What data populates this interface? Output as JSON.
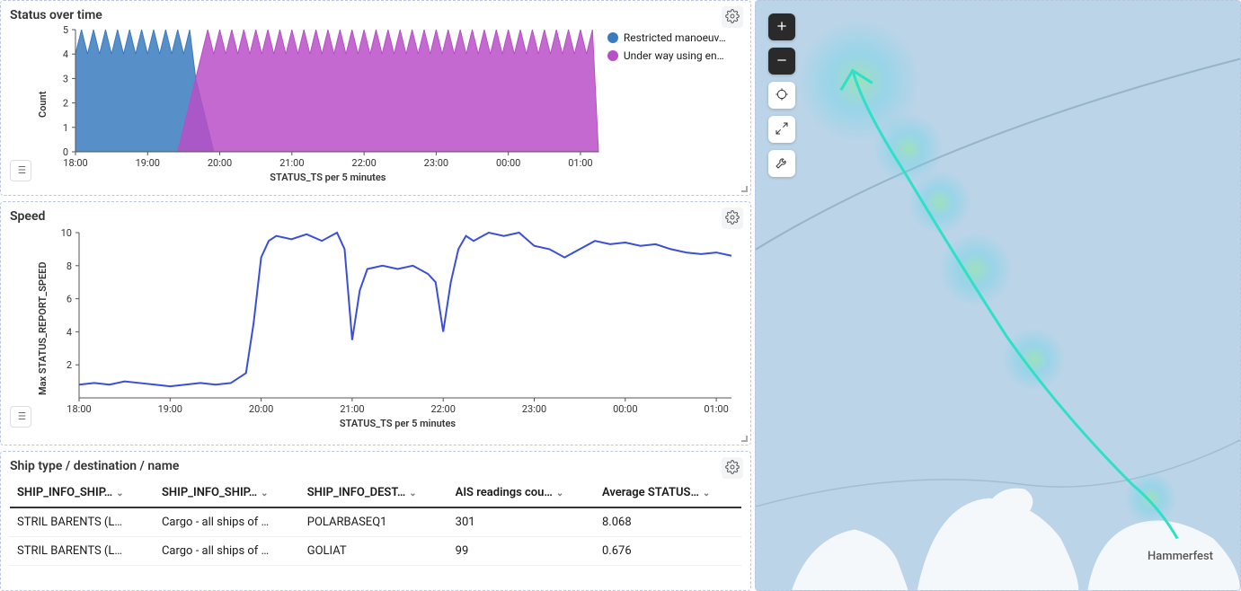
{
  "panels": {
    "status": {
      "title": "Status over time",
      "ylabel": "Count",
      "xlabel": "STATUS_TS per 5 minutes",
      "legend": [
        {
          "label": "Restricted manoeuv…",
          "color": "#3a7bbf"
        },
        {
          "label": "Under way using en…",
          "color": "#b84fc7"
        }
      ]
    },
    "speed": {
      "title": "Speed",
      "ylabel": "Max STATUS_REPORT_SPEED",
      "xlabel": "STATUS_TS per 5 minutes"
    },
    "table": {
      "title": "Ship type / destination / name",
      "headers": [
        "SHIP_INFO_SHIP…",
        "SHIP_INFO_SHIP…",
        "SHIP_INFO_DEST…",
        "AIS readings cou…",
        "Average STATUS…"
      ],
      "rows": [
        {
          "c0": "STRIL BARENTS (L…",
          "c1": "Cargo - all ships of …",
          "c2": "POLARBASEQ1",
          "c3": "301",
          "c4": "8.068"
        },
        {
          "c0": "STRIL BARENTS (L…",
          "c1": "Cargo - all ships of …",
          "c2": "GOLIAT",
          "c3": "99",
          "c4": "0.676"
        }
      ]
    }
  },
  "map": {
    "place_label": "Hammerfest",
    "heat_color_inner": "#7cf08a",
    "heat_color_outer": "#64d4e8",
    "track_color": "#2fe0c9",
    "baseline_color": "#6f95aa"
  },
  "chart_data": [
    {
      "type": "area",
      "title": "Status over time",
      "xlabel": "STATUS_TS per 5 minutes",
      "ylabel": "Count",
      "ylim": [
        0,
        5
      ],
      "x_ticks": [
        "18:00",
        "19:00",
        "20:00",
        "21:00",
        "22:00",
        "23:00",
        "00:00",
        "01:00"
      ],
      "y_ticks": [
        0,
        1,
        2,
        3,
        4,
        5
      ],
      "categories_minutes": [
        0,
        5,
        10,
        15,
        20,
        25,
        30,
        35,
        40,
        45,
        50,
        55,
        60,
        65,
        70,
        75,
        80,
        85,
        90,
        95,
        100,
        105,
        110,
        115,
        120,
        125,
        130,
        135,
        140,
        145,
        150,
        155,
        160,
        165,
        170,
        175,
        180,
        185,
        190,
        195,
        200,
        205,
        210,
        215,
        220,
        225,
        230,
        235,
        240,
        245,
        250,
        255,
        260,
        265,
        270,
        275,
        280,
        285,
        290,
        295,
        300,
        305,
        310,
        315,
        320,
        325,
        330,
        335,
        340,
        345,
        350,
        355,
        360,
        365,
        370,
        375,
        380,
        385,
        390,
        395,
        400,
        405,
        410,
        415,
        420,
        425,
        430,
        435
      ],
      "series": [
        {
          "name": "Restricted manoeuvrability",
          "color": "#3a7bbf",
          "values": [
            4,
            5,
            4,
            5,
            4,
            5,
            4,
            5,
            4,
            5,
            4,
            5,
            4,
            5,
            4,
            5,
            4,
            5,
            4,
            5,
            3,
            2,
            1,
            0,
            0,
            0,
            0,
            0,
            0,
            0,
            0,
            0,
            0,
            0,
            0,
            0,
            0,
            0,
            0,
            0,
            0,
            0,
            0,
            0,
            0,
            0,
            0,
            0,
            0,
            0,
            0,
            0,
            0,
            0,
            0,
            0,
            0,
            0,
            0,
            0,
            0,
            0,
            0,
            0,
            0,
            0,
            0,
            0,
            0,
            0,
            0,
            0,
            0,
            0,
            0,
            0,
            0,
            0,
            0,
            0,
            0,
            0,
            0,
            0,
            0,
            0,
            0,
            0
          ]
        },
        {
          "name": "Under way using engine",
          "color": "#b84fc7",
          "values": [
            0,
            0,
            0,
            0,
            0,
            0,
            0,
            0,
            0,
            0,
            0,
            0,
            0,
            0,
            0,
            0,
            0,
            0,
            1,
            2,
            3,
            4,
            5,
            4,
            5,
            4,
            5,
            4,
            5,
            4,
            5,
            4,
            5,
            4,
            5,
            4,
            5,
            4,
            5,
            4,
            5,
            4,
            5,
            4,
            5,
            4,
            5,
            4,
            5,
            4,
            5,
            4,
            5,
            4,
            5,
            4,
            5,
            4,
            5,
            4,
            5,
            4,
            5,
            4,
            5,
            4,
            5,
            4,
            5,
            4,
            5,
            4,
            5,
            4,
            5,
            4,
            5,
            4,
            5,
            4,
            5,
            4,
            5,
            4,
            5,
            4,
            5,
            0
          ]
        }
      ]
    },
    {
      "type": "line",
      "title": "Speed",
      "xlabel": "STATUS_TS per 5 minutes",
      "ylabel": "Max STATUS_REPORT_SPEED",
      "ylim": [
        0,
        10
      ],
      "x_ticks": [
        "18:00",
        "19:00",
        "20:00",
        "21:00",
        "22:00",
        "23:00",
        "00:00",
        "01:00"
      ],
      "y_ticks": [
        2,
        4,
        6,
        8,
        10
      ],
      "series": [
        {
          "name": "Max STATUS_REPORT_SPEED",
          "color": "#3b4fd6",
          "x_minutes": [
            0,
            10,
            20,
            30,
            40,
            50,
            60,
            70,
            80,
            90,
            100,
            110,
            115,
            120,
            125,
            130,
            140,
            150,
            160,
            170,
            175,
            180,
            185,
            190,
            200,
            210,
            220,
            230,
            235,
            240,
            245,
            250,
            255,
            260,
            270,
            280,
            290,
            300,
            310,
            320,
            330,
            340,
            350,
            360,
            370,
            380,
            390,
            400,
            410,
            420,
            430
          ],
          "values": [
            0.8,
            0.9,
            0.8,
            1.0,
            0.9,
            0.8,
            0.7,
            0.8,
            0.9,
            0.8,
            0.9,
            1.5,
            4.5,
            8.5,
            9.5,
            9.8,
            9.6,
            9.9,
            9.5,
            10.0,
            9.0,
            3.5,
            6.5,
            7.8,
            8.0,
            7.8,
            8.0,
            7.5,
            7.0,
            4.0,
            7.0,
            9.0,
            9.8,
            9.5,
            10.0,
            9.8,
            10.0,
            9.2,
            9.0,
            8.5,
            9.0,
            9.5,
            9.3,
            9.4,
            9.2,
            9.3,
            9.0,
            8.8,
            8.7,
            8.8,
            8.6
          ]
        }
      ]
    },
    {
      "type": "table",
      "title": "Ship type / destination / name",
      "columns": [
        "SHIP_INFO_SHIP_NAME",
        "SHIP_INFO_SHIP_TYPE",
        "SHIP_INFO_DESTINATION",
        "AIS readings count",
        "Average STATUS_REPORT_SPEED"
      ],
      "rows": [
        [
          "STRIL BARENTS (L…)",
          "Cargo - all ships of …",
          "POLARBASEQ1",
          301,
          8.068
        ],
        [
          "STRIL BARENTS (L…)",
          "Cargo - all ships of …",
          "GOLIAT",
          99,
          0.676
        ]
      ]
    }
  ]
}
